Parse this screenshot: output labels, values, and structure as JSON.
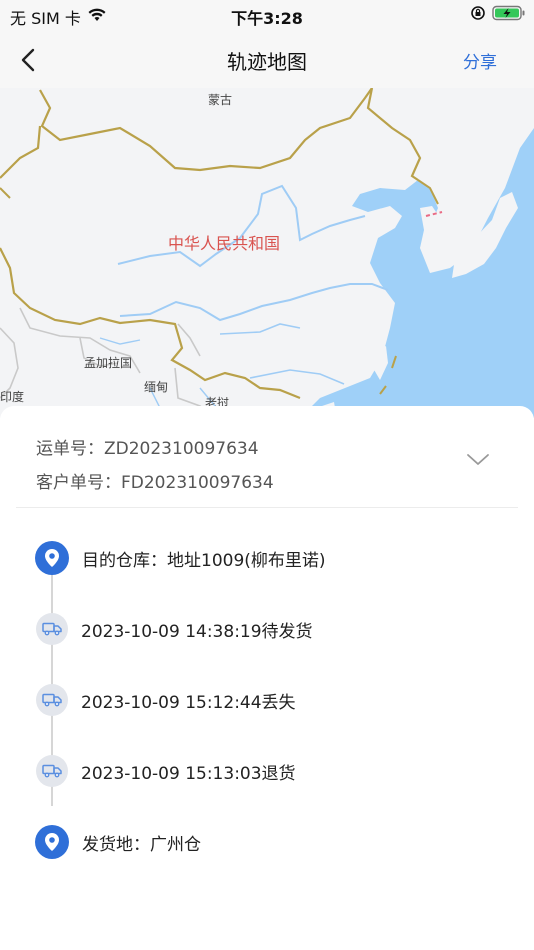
{
  "status_bar": {
    "carrier": "无 SIM 卡",
    "time": "下午3:28"
  },
  "nav": {
    "title": "轨迹地图",
    "share_label": "分享"
  },
  "map": {
    "labels": {
      "mongolia": "蒙古",
      "china": "中华人民共和国",
      "bangladesh": "孟加拉国",
      "myanmar": "缅甸",
      "india": "印度",
      "laos": "老挝"
    }
  },
  "order": {
    "waybill_label": "运单号：",
    "waybill_no": "ZD202310097634",
    "customer_label": "客户单号：",
    "customer_no": "FD202310097634"
  },
  "timeline": [
    {
      "icon": "location-pin-icon",
      "text": "目的仓库：地址1009(柳布里诺)"
    },
    {
      "icon": "truck-icon",
      "text": "2023-10-09 14:38:19待发货"
    },
    {
      "icon": "truck-icon",
      "text": "2023-10-09 15:12:44丢失"
    },
    {
      "icon": "truck-icon",
      "text": "2023-10-09 15:13:03退货"
    },
    {
      "icon": "location-pin-icon",
      "text": "发货地：广州仓"
    }
  ],
  "colors": {
    "accent": "#2f6fd8",
    "border_line": "#b9a14a",
    "river": "#9fccf5",
    "sea": "#9fd0f8"
  }
}
